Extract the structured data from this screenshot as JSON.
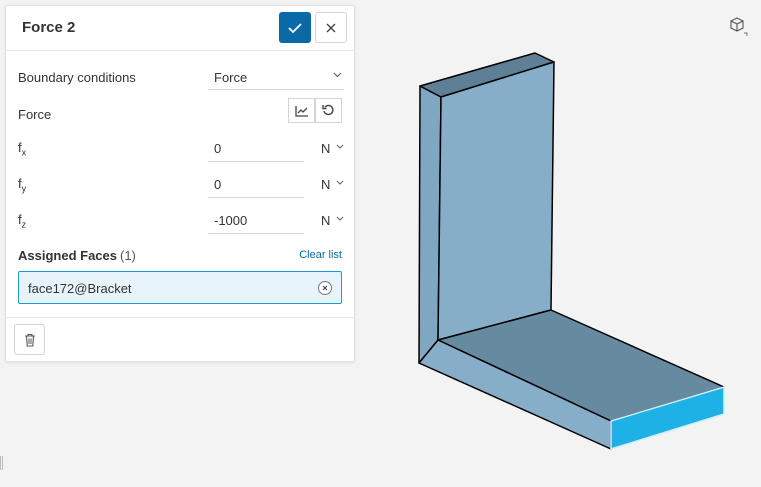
{
  "panel": {
    "title": "Force 2",
    "confirm_icon": "check-icon",
    "close_icon": "close-icon",
    "boundary_label": "Boundary conditions",
    "boundary_value": "Force",
    "force_label": "Force",
    "components": [
      {
        "label": "f",
        "sub": "x",
        "value": "0",
        "unit": "N"
      },
      {
        "label": "f",
        "sub": "y",
        "value": "0",
        "unit": "N"
      },
      {
        "label": "f",
        "sub": "z",
        "value": "-1000",
        "unit": "N"
      }
    ],
    "assigned_title": "Assigned Faces",
    "assigned_count": "(1)",
    "clear_list": "Clear list",
    "faces": [
      "face172@Bracket"
    ]
  },
  "colors": {
    "accent": "#0a6aa8",
    "selected_face": "#1eb1e6",
    "model_body": "#86aec8",
    "model_top": "#668aa0"
  }
}
